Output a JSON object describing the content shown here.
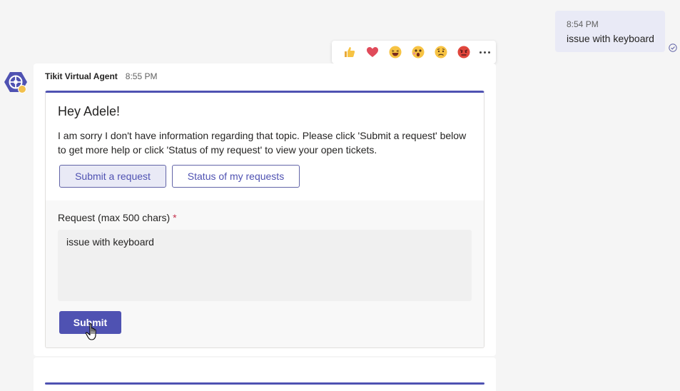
{
  "outgoing": {
    "time": "8:54 PM",
    "text": "issue with keyboard"
  },
  "reactions": {
    "items": [
      "like",
      "heart",
      "laugh",
      "surprised",
      "sad",
      "angry"
    ],
    "more": "more-options"
  },
  "message": {
    "sender": "Tikit Virtual Agent",
    "time": "8:55 PM",
    "card": {
      "title": "Hey Adele!",
      "body": "I am sorry I don't have information regarding that topic. Please click 'Submit a request' below to get more help or click 'Status of my request' to view your open tickets.",
      "buttons": {
        "submit_request": "Submit a request",
        "status": "Status of my requests"
      },
      "form": {
        "label": "Request (max 500 chars)",
        "required_mark": "*",
        "value": "issue with keyboard",
        "submit": "Submit"
      }
    }
  },
  "colors": {
    "accent": "#4f52b2",
    "bubble": "#e9eaf6",
    "required": "#c4314b"
  }
}
